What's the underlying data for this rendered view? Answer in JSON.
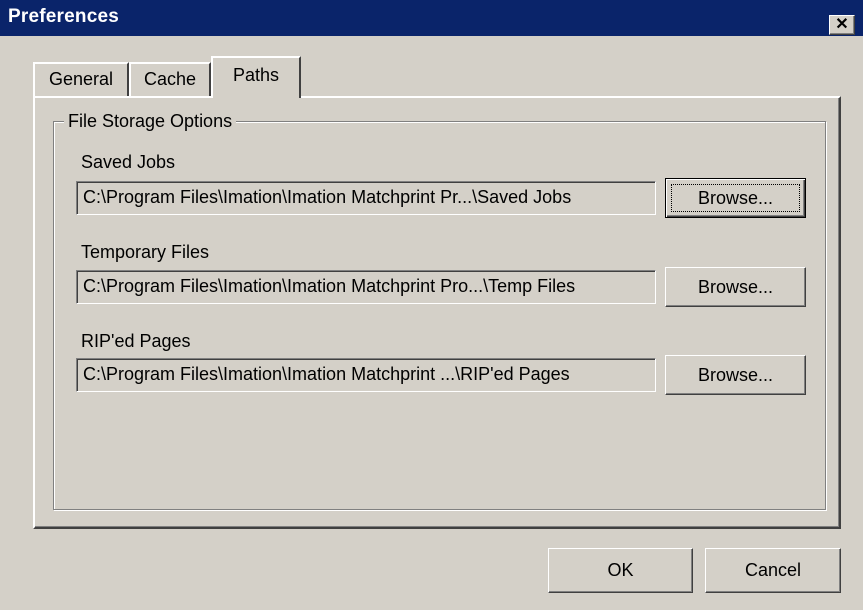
{
  "window": {
    "title": "Preferences",
    "close_glyph": "✕"
  },
  "tabs": [
    {
      "label": "General",
      "active": false
    },
    {
      "label": "Cache",
      "active": false
    },
    {
      "label": "Paths",
      "active": true
    }
  ],
  "group": {
    "legend": "File Storage Options",
    "fields": [
      {
        "label": "Saved Jobs",
        "value": "C:\\Program Files\\Imation\\Imation Matchprint Pr...\\Saved Jobs",
        "button": "Browse..."
      },
      {
        "label": "Temporary Files",
        "value": "C:\\Program Files\\Imation\\Imation Matchprint Pro...\\Temp Files",
        "button": "Browse..."
      },
      {
        "label": "RIP'ed Pages",
        "value": "C:\\Program Files\\Imation\\Imation Matchprint ...\\RIP'ed Pages",
        "button": "Browse..."
      }
    ]
  },
  "footer": {
    "ok": "OK",
    "cancel": "Cancel"
  },
  "colors": {
    "titlebar": "#0a246a",
    "face": "#d4d0c8"
  }
}
